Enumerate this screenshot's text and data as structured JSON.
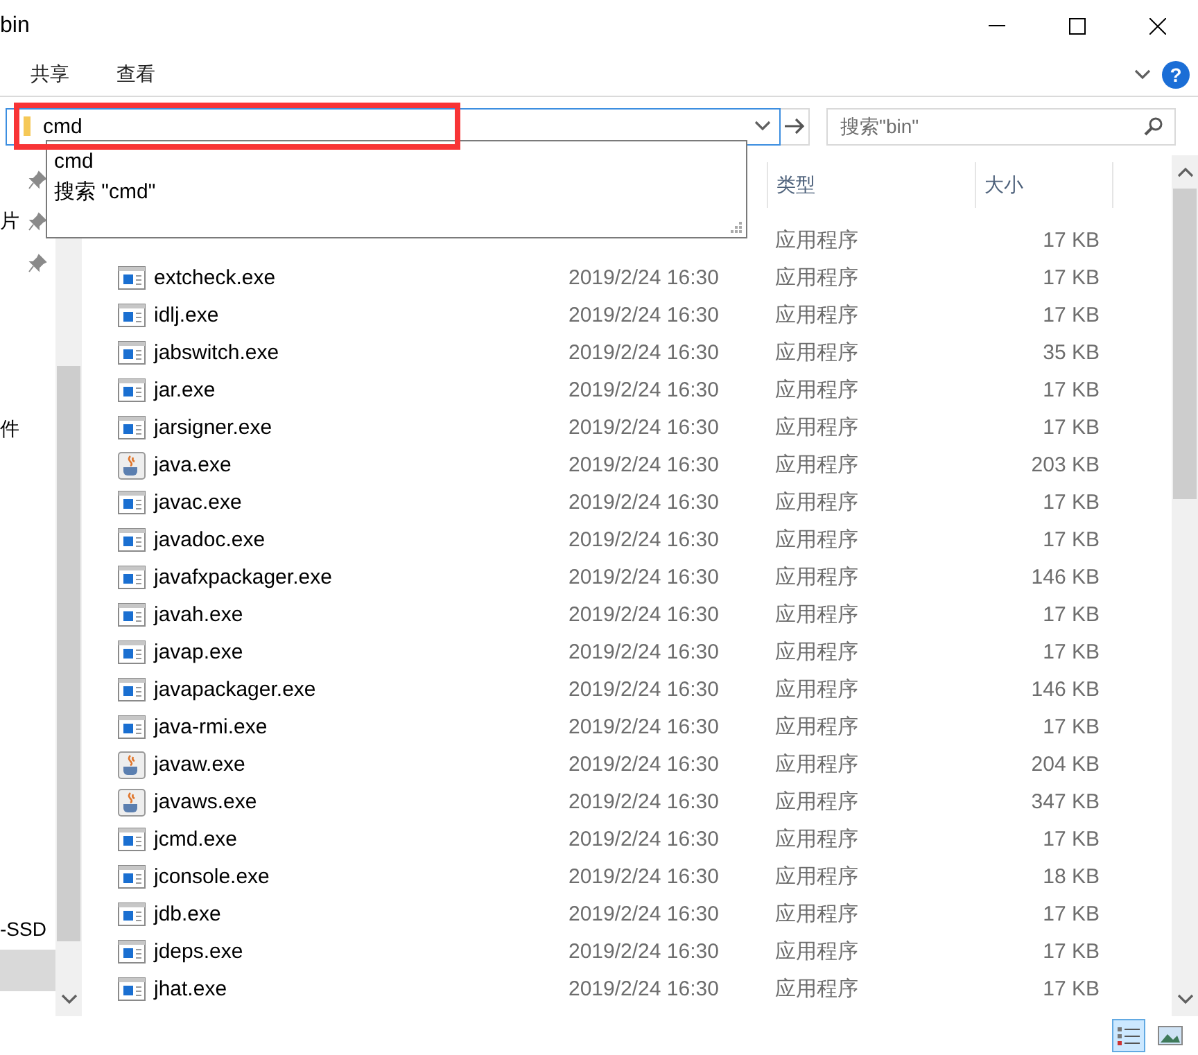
{
  "window": {
    "title": "bin"
  },
  "ribbon": {
    "tabs": [
      {
        "label": "共享",
        "selected": false
      },
      {
        "label": "查看",
        "selected": false
      }
    ],
    "help": "?"
  },
  "address_bar": {
    "value": "cmd",
    "focused": true
  },
  "autocomplete": {
    "items": [
      "cmd",
      "搜索 \"cmd\""
    ]
  },
  "search": {
    "placeholder": "搜索\"bin\""
  },
  "nav_pane": {
    "items": [
      {
        "pinned": true,
        "selected": false
      },
      {
        "label": "片",
        "pinned": true,
        "selected": false
      },
      {
        "pinned": true,
        "selected": false
      },
      {
        "pinned": false,
        "selected": false
      },
      {
        "pinned": false,
        "selected": false
      },
      {
        "pinned": false,
        "selected": false
      },
      {
        "label": "件",
        "pinned": false,
        "selected": false
      },
      {
        "pinned": false,
        "selected": false
      },
      {
        "pinned": false,
        "selected": false
      },
      {
        "pinned": false,
        "selected": false
      },
      {
        "pinned": false,
        "selected": false
      },
      {
        "pinned": false,
        "selected": false
      },
      {
        "pinned": false,
        "selected": false
      },
      {
        "pinned": false,
        "selected": false
      },
      {
        "pinned": false,
        "selected": false
      },
      {
        "pinned": false,
        "selected": false
      },
      {
        "pinned": false,
        "selected": false
      },
      {
        "pinned": false,
        "selected": false
      },
      {
        "label": "-SSD",
        "pinned": false,
        "selected": false
      },
      {
        "pinned": false,
        "selected": true
      }
    ]
  },
  "table": {
    "columns": [
      "类型",
      "大小"
    ],
    "rows": [
      {
        "type": "应用程序",
        "size": "17 KB"
      },
      {
        "name": "extcheck.exe",
        "date": "2019/2/24 16:30",
        "type": "应用程序",
        "size": "17 KB",
        "kind": "exe"
      },
      {
        "name": "idlj.exe",
        "date": "2019/2/24 16:30",
        "type": "应用程序",
        "size": "17 KB",
        "kind": "exe"
      },
      {
        "name": "jabswitch.exe",
        "date": "2019/2/24 16:30",
        "type": "应用程序",
        "size": "35 KB",
        "kind": "exe"
      },
      {
        "name": "jar.exe",
        "date": "2019/2/24 16:30",
        "type": "应用程序",
        "size": "17 KB",
        "kind": "exe"
      },
      {
        "name": "jarsigner.exe",
        "date": "2019/2/24 16:30",
        "type": "应用程序",
        "size": "17 KB",
        "kind": "exe"
      },
      {
        "name": "java.exe",
        "date": "2019/2/24 16:30",
        "type": "应用程序",
        "size": "203 KB",
        "kind": "java"
      },
      {
        "name": "javac.exe",
        "date": "2019/2/24 16:30",
        "type": "应用程序",
        "size": "17 KB",
        "kind": "exe"
      },
      {
        "name": "javadoc.exe",
        "date": "2019/2/24 16:30",
        "type": "应用程序",
        "size": "17 KB",
        "kind": "exe"
      },
      {
        "name": "javafxpackager.exe",
        "date": "2019/2/24 16:30",
        "type": "应用程序",
        "size": "146 KB",
        "kind": "exe"
      },
      {
        "name": "javah.exe",
        "date": "2019/2/24 16:30",
        "type": "应用程序",
        "size": "17 KB",
        "kind": "exe"
      },
      {
        "name": "javap.exe",
        "date": "2019/2/24 16:30",
        "type": "应用程序",
        "size": "17 KB",
        "kind": "exe"
      },
      {
        "name": "javapackager.exe",
        "date": "2019/2/24 16:30",
        "type": "应用程序",
        "size": "146 KB",
        "kind": "exe"
      },
      {
        "name": "java-rmi.exe",
        "date": "2019/2/24 16:30",
        "type": "应用程序",
        "size": "17 KB",
        "kind": "exe"
      },
      {
        "name": "javaw.exe",
        "date": "2019/2/24 16:30",
        "type": "应用程序",
        "size": "204 KB",
        "kind": "java"
      },
      {
        "name": "javaws.exe",
        "date": "2019/2/24 16:30",
        "type": "应用程序",
        "size": "347 KB",
        "kind": "java"
      },
      {
        "name": "jcmd.exe",
        "date": "2019/2/24 16:30",
        "type": "应用程序",
        "size": "17 KB",
        "kind": "exe"
      },
      {
        "name": "jconsole.exe",
        "date": "2019/2/24 16:30",
        "type": "应用程序",
        "size": "18 KB",
        "kind": "exe"
      },
      {
        "name": "jdb.exe",
        "date": "2019/2/24 16:30",
        "type": "应用程序",
        "size": "17 KB",
        "kind": "exe"
      },
      {
        "name": "jdeps.exe",
        "date": "2019/2/24 16:30",
        "type": "应用程序",
        "size": "17 KB",
        "kind": "exe"
      },
      {
        "name": "jhat.exe",
        "date": "2019/2/24 16:30",
        "type": "应用程序",
        "size": "17 KB",
        "kind": "exe"
      }
    ]
  },
  "status_bar": {
    "views": [
      {
        "kind": "details",
        "selected": true
      },
      {
        "kind": "large-icons",
        "selected": false
      }
    ]
  }
}
